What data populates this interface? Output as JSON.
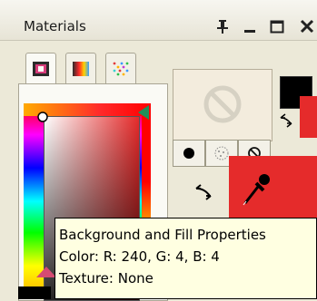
{
  "window": {
    "title": "Materials",
    "controls": [
      "pin-icon",
      "minimize-icon",
      "maximize-icon",
      "close-icon"
    ]
  },
  "tabs": [
    {
      "name": "frame-tab",
      "icon": "frame-palette-icon"
    },
    {
      "name": "rainbow-tab",
      "icon": "rainbow-icon"
    },
    {
      "name": "swatches-tab",
      "icon": "dots-swatches-icon"
    }
  ],
  "colors": {
    "foreground": "#000000",
    "background": "#f00404",
    "preview": "#f3ecdd"
  },
  "tooltip": {
    "line1": "Background and Fill Properties",
    "line2": "Color: R: 240, G: 4, B: 4",
    "line3": "Texture: None"
  }
}
